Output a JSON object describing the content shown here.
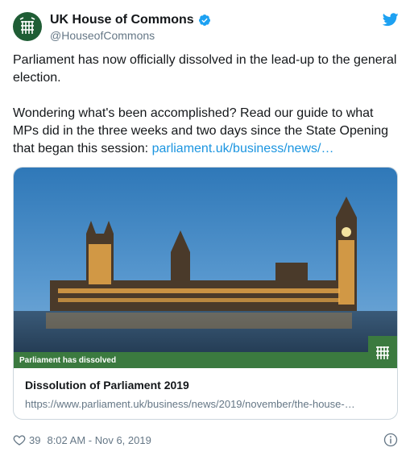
{
  "account": {
    "display_name": "UK House of Commons",
    "handle": "@HouseofCommons",
    "verified": true,
    "avatar_icon": "portcullis-icon",
    "brand_color": "#1f5d35"
  },
  "tweet": {
    "paragraph1": "Parliament has now officially dissolved in the lead-up to the general election.",
    "paragraph2_text": "Wondering what's been accomplished? Read our guide to what MPs did in the three weeks and two days since the State Opening that began this session: ",
    "link_text": "parliament.uk/business/news/…",
    "link_color": "#1b95e0"
  },
  "card": {
    "image_banner": "Parliament has dissolved",
    "title": "Dissolution of Parliament 2019",
    "url": "https://www.parliament.uk/business/news/2019/november/the-house-…",
    "banner_color": "#3b7a3f"
  },
  "footer": {
    "likes": "39",
    "timestamp": "8:02 AM - Nov 6, 2019",
    "heart_icon": "heart-icon",
    "info_icon": "info-icon"
  },
  "header_icon": "twitter-bird-icon"
}
